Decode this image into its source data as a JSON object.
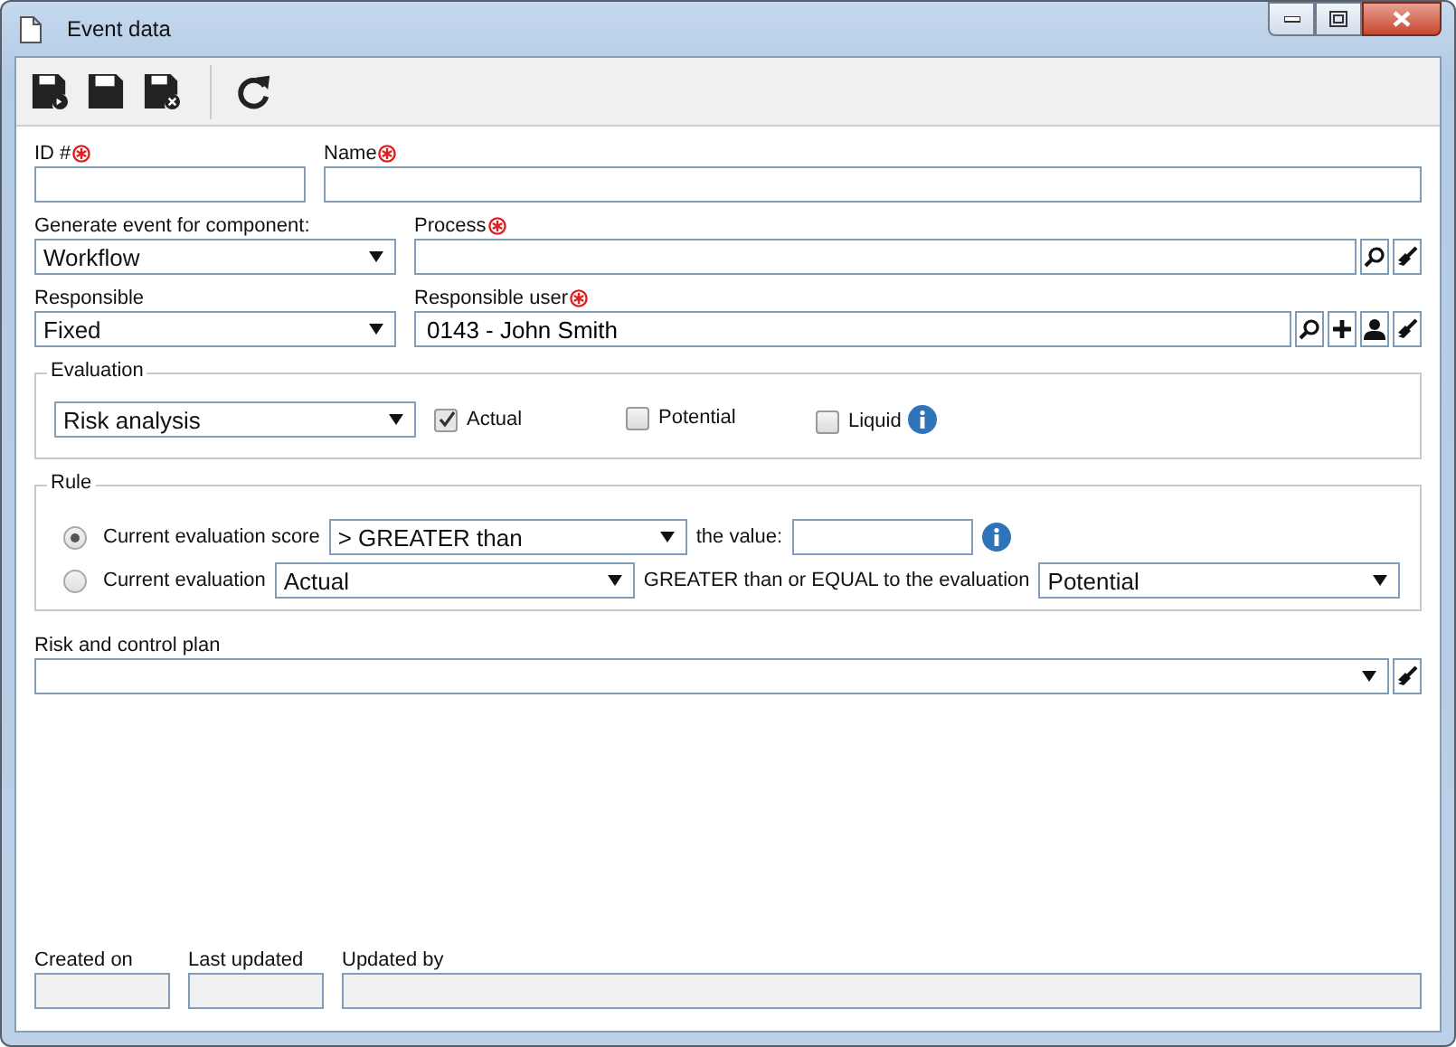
{
  "window": {
    "title": "Event data"
  },
  "id_field": {
    "label": "ID #",
    "required": true
  },
  "name_field": {
    "label": "Name",
    "required": true
  },
  "component": {
    "label": "Generate event for component:",
    "value": "Workflow"
  },
  "process": {
    "label": "Process",
    "required": true
  },
  "responsible": {
    "label": "Responsible",
    "value": "Fixed"
  },
  "responsible_user": {
    "label": "Responsible user",
    "required": true,
    "value": "0143 - John Smith"
  },
  "evaluation": {
    "legend": "Evaluation",
    "type": "Risk analysis",
    "options": [
      {
        "label": "Actual",
        "checked": true
      },
      {
        "label": "Potential",
        "checked": false
      },
      {
        "label": "Liquid",
        "checked": false
      }
    ]
  },
  "rule": {
    "legend": "Rule",
    "options": [
      {
        "kind": "score",
        "selected": true,
        "label": "Current evaluation score",
        "operator": "> GREATER than",
        "value_label": "the value:"
      },
      {
        "kind": "compare",
        "selected": false,
        "label": "Current evaluation",
        "operator": "Actual",
        "middle": "GREATER than or EQUAL to the evaluation",
        "compare_to": "Potential"
      }
    ]
  },
  "plan": {
    "label": "Risk and control plan"
  },
  "footer": [
    {
      "label": "Created on",
      "disabled": true
    },
    {
      "label": "Last updated",
      "disabled": true
    },
    {
      "label": "Updated by",
      "disabled": true
    }
  ]
}
